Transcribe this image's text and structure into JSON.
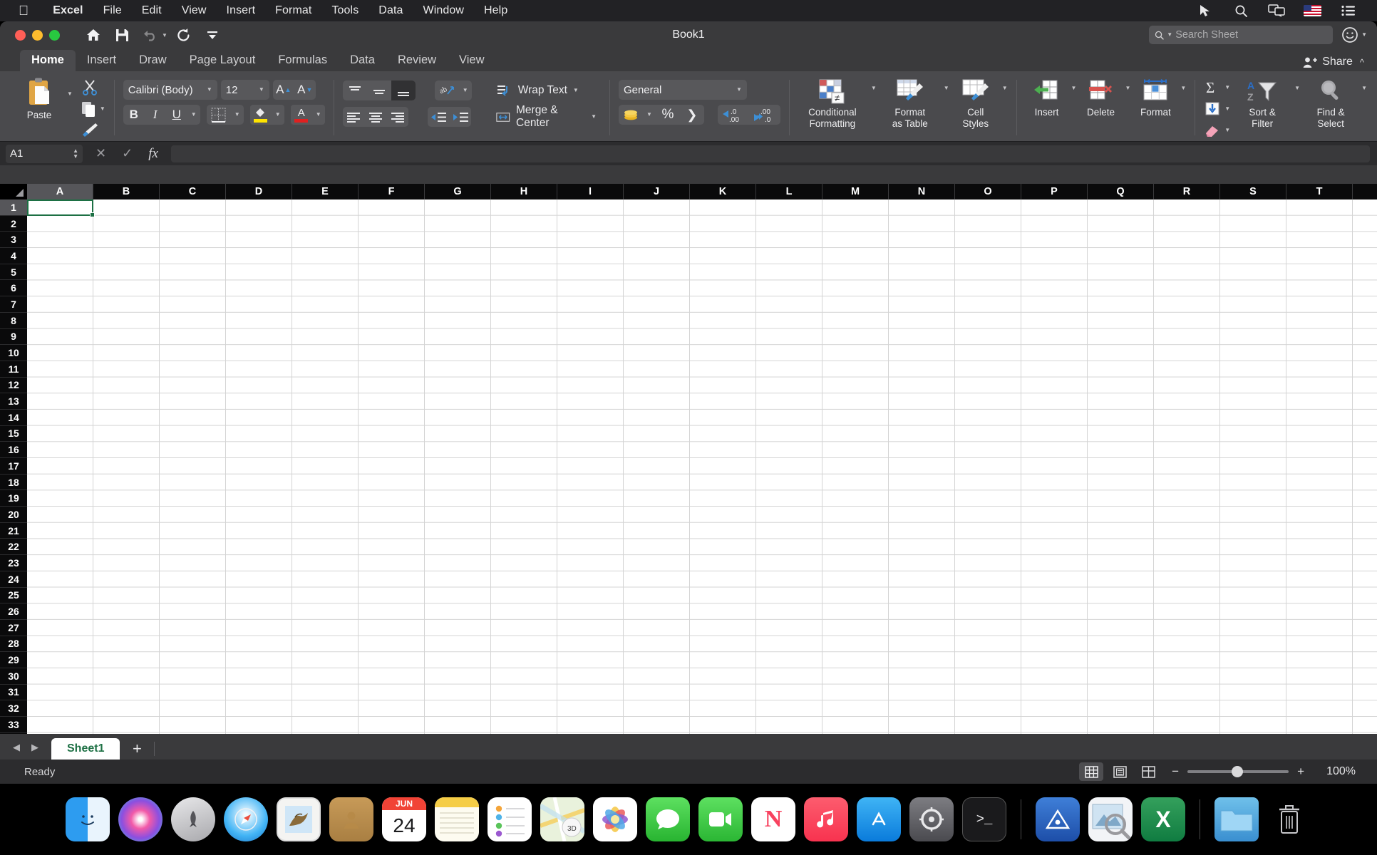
{
  "menubar": {
    "apple_icon": "apple-logo",
    "items": [
      "Excel",
      "File",
      "Edit",
      "View",
      "Insert",
      "Format",
      "Tools",
      "Data",
      "Window",
      "Help"
    ],
    "right_icons": [
      "pointer-icon",
      "search-icon",
      "screen-mirroring-icon",
      "us-flag-icon",
      "control-center-icon"
    ]
  },
  "titlebar": {
    "title": "Book1",
    "quick_access": [
      "home-icon",
      "save-icon",
      "undo-icon",
      "redo-icon",
      "customize-toolbar-icon"
    ],
    "search": {
      "placeholder": "Search Sheet",
      "value": ""
    },
    "account_icon": "account-smiley-icon"
  },
  "ribbon_tabs": {
    "items": [
      "Home",
      "Insert",
      "Draw",
      "Page Layout",
      "Formulas",
      "Data",
      "Review",
      "View"
    ],
    "active": "Home",
    "share_label": "Share",
    "collapse_icon": "chevron-up-icon"
  },
  "ribbon": {
    "clipboard": {
      "paste_label": "Paste",
      "cut_icon": "scissors-icon",
      "copy_icon": "copy-icon",
      "format_painter_icon": "paintbrush-icon"
    },
    "font": {
      "family": "Calibri (Body)",
      "size": "12",
      "grow_label": "A",
      "shrink_label": "A",
      "bold": "B",
      "italic": "I",
      "underline": "U",
      "borders_icon": "borders-icon",
      "fill_color": "#ffe400",
      "font_color": "#e02020",
      "font_color_label": "A"
    },
    "alignment": {
      "wrap_text_label": "Wrap Text",
      "merge_center_label": "Merge & Center",
      "orientation_icon": "text-orientation-icon",
      "valign": [
        "align-top-icon",
        "align-middle-icon",
        "align-bottom-icon"
      ],
      "halign": [
        "align-left-icon",
        "align-center-icon",
        "align-right-icon"
      ],
      "indent": [
        "decrease-indent-icon",
        "increase-indent-icon"
      ]
    },
    "number": {
      "format": "General",
      "accounting_icon": "coins-icon",
      "percent_label": "%",
      "comma_label": "❯",
      "increase_decimal": ".00",
      "decrease_decimal": ".0",
      "inc_dec_top": ".0",
      "inc_dec_bottom": ".00",
      "dec_dec_top": ".00",
      "dec_dec_bottom": ".0"
    },
    "styles": [
      {
        "label_line1": "Conditional",
        "label_line2": "Formatting",
        "icon": "conditional-formatting-icon"
      },
      {
        "label_line1": "Format",
        "label_line2": "as Table",
        "icon": "format-as-table-icon"
      },
      {
        "label_line1": "Cell",
        "label_line2": "Styles",
        "icon": "cell-styles-icon"
      }
    ],
    "cells": [
      {
        "label": "Insert",
        "icon": "insert-cells-icon"
      },
      {
        "label": "Delete",
        "icon": "delete-cells-icon"
      },
      {
        "label": "Format",
        "icon": "format-cells-icon"
      }
    ],
    "editing": {
      "autosum_icon": "autosum-sigma-icon",
      "fill_icon": "fill-down-icon",
      "clear_icon": "eraser-icon",
      "sort_filter_line1": "Sort &",
      "sort_filter_line2": "Filter",
      "find_select_line1": "Find &",
      "find_select_line2": "Select"
    }
  },
  "formula_bar": {
    "name_box": "A1",
    "cancel_icon": "cancel-x-icon",
    "confirm_icon": "confirm-check-icon",
    "function_icon": "fx-icon",
    "formula_value": ""
  },
  "grid": {
    "columns": [
      "A",
      "B",
      "C",
      "D",
      "E",
      "F",
      "G",
      "H",
      "I",
      "J",
      "K",
      "L",
      "M",
      "N",
      "O",
      "P",
      "Q",
      "R",
      "S",
      "T"
    ],
    "rows": [
      "1",
      "2",
      "3",
      "4",
      "5",
      "6",
      "7",
      "8",
      "9",
      "10",
      "11",
      "12",
      "13",
      "14",
      "15",
      "16",
      "17",
      "18",
      "19",
      "20",
      "21",
      "22",
      "23",
      "24",
      "25",
      "26",
      "27",
      "28",
      "29",
      "30",
      "31",
      "32",
      "33"
    ],
    "selected_cell": "A1",
    "selected_column": "A",
    "selected_row": "1",
    "selection_color": "#1d7044"
  },
  "sheet_bar": {
    "prev_icon": "prev-sheet-icon",
    "next_icon": "next-sheet-icon",
    "tabs": [
      "Sheet1"
    ],
    "active_tab": "Sheet1",
    "add_label": "+"
  },
  "status_bar": {
    "status": "Ready",
    "views": [
      "normal-view-icon",
      "page-layout-view-icon",
      "page-break-view-icon"
    ],
    "active_view": "normal-view-icon",
    "zoom_out": "−",
    "zoom_in": "+",
    "zoom_value": "100%"
  },
  "dock": {
    "items": [
      {
        "name": "finder",
        "glyph": ""
      },
      {
        "name": "siri",
        "glyph": ""
      },
      {
        "name": "launchpad",
        "glyph": ""
      },
      {
        "name": "safari",
        "glyph": ""
      },
      {
        "name": "mail",
        "glyph": ""
      },
      {
        "name": "contacts",
        "glyph": ""
      },
      {
        "name": "calendar",
        "glyph": "",
        "month": "JUN",
        "day": "24"
      },
      {
        "name": "notes",
        "glyph": ""
      },
      {
        "name": "reminders",
        "glyph": ""
      },
      {
        "name": "maps",
        "glyph": ""
      },
      {
        "name": "photos",
        "glyph": ""
      },
      {
        "name": "messages",
        "glyph": ""
      },
      {
        "name": "facetime",
        "glyph": ""
      },
      {
        "name": "news",
        "glyph": "N"
      },
      {
        "name": "music",
        "glyph": ""
      },
      {
        "name": "app-store",
        "glyph": "A"
      },
      {
        "name": "system-preferences",
        "glyph": ""
      },
      {
        "name": "terminal",
        "glyph": ">_"
      },
      {
        "name": "xcode",
        "glyph": ""
      },
      {
        "name": "preview",
        "glyph": ""
      },
      {
        "name": "excel",
        "glyph": "X"
      },
      {
        "name": "downloads-folder",
        "glyph": ""
      },
      {
        "name": "trash",
        "glyph": ""
      }
    ]
  }
}
